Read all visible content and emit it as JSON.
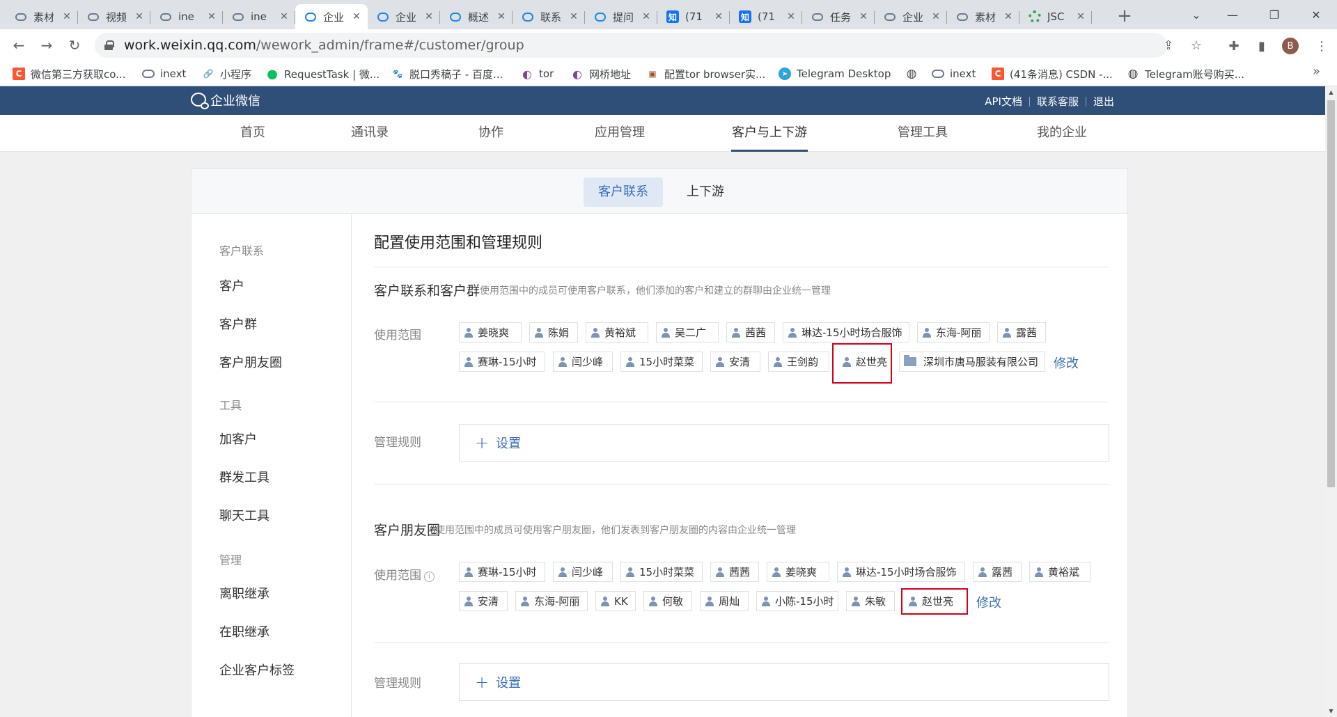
{
  "browser": {
    "tabs": [
      {
        "title": "素材",
        "icon": "cloud-icon"
      },
      {
        "title": "视频",
        "icon": "cloud-icon"
      },
      {
        "title": "ine",
        "icon": "cloud-icon"
      },
      {
        "title": "ine",
        "icon": "cloud-icon"
      },
      {
        "title": "企业",
        "icon": "wecom-icon",
        "active": true
      },
      {
        "title": "企业",
        "icon": "wecom-icon"
      },
      {
        "title": "概述",
        "icon": "wecom-icon"
      },
      {
        "title": "联系",
        "icon": "wecom-icon"
      },
      {
        "title": "提问",
        "icon": "wecom-icon"
      },
      {
        "title": "(71",
        "icon": "zhihu-icon"
      },
      {
        "title": "(71",
        "icon": "zhihu-icon"
      },
      {
        "title": "任务",
        "icon": "cloud-icon"
      },
      {
        "title": "企业",
        "icon": "cloud-icon"
      },
      {
        "title": "素材",
        "icon": "cloud-icon"
      },
      {
        "title": "JSC",
        "icon": "gear-icon"
      }
    ],
    "zhi_glyph": "知",
    "close_glyph": "✕",
    "new_tab_glyph": "+",
    "window_controls": {
      "dropdown": "⌄",
      "minimize": "—",
      "restore": "❐",
      "close": "✕"
    },
    "nav": {
      "back": "←",
      "forward": "→",
      "reload": "↻"
    },
    "url_host": "work.weixin.qq.com",
    "url_path": "/wework_admin/frame#/customer/group",
    "omnibox_icons": {
      "share": "⇪",
      "bookmark_star": "☆"
    },
    "extension_icons": {
      "extensions": "✚",
      "side_panel": "▮"
    },
    "profile_initial": "B",
    "bookmarks": [
      {
        "label": "微信第三方获取co...",
        "icon": "csdn-icon"
      },
      {
        "label": "inext",
        "icon": "cloud-icon"
      },
      {
        "label": "小程序",
        "icon": "link-icon"
      },
      {
        "label": "RequestTask | 微...",
        "icon": "wechat-icon"
      },
      {
        "label": "脱口秀稿子 - 百度...",
        "icon": "baidu-icon"
      },
      {
        "label": "tor",
        "icon": "tor-icon"
      },
      {
        "label": "网桥地址",
        "icon": "tor-icon"
      },
      {
        "label": "配置tor browser实...",
        "icon": "page-icon"
      },
      {
        "label": "Telegram Desktop",
        "icon": "telegram-icon"
      },
      {
        "label": "",
        "icon": "globe-icon"
      },
      {
        "label": "inext",
        "icon": "cloud-icon"
      },
      {
        "label": "(41条消息) CSDN -...",
        "icon": "csdn-icon"
      },
      {
        "label": "Telegram账号购买...",
        "icon": "globe-icon"
      }
    ],
    "bookmark_glyphs": {
      "csdn": "C",
      "link": "🔗",
      "wechat": "●",
      "baidu": "🐾",
      "tor": "◐",
      "page": "▣",
      "telegram": "➤",
      "globe": "◍"
    },
    "bookmarks_more": "»"
  },
  "header": {
    "logo_text": "企业微信",
    "links": [
      "API文档",
      "联系客服",
      "退出"
    ]
  },
  "nav": {
    "items": [
      "首页",
      "通讯录",
      "协作",
      "应用管理",
      "客户与上下游",
      "管理工具",
      "我的企业"
    ],
    "active_index": 4
  },
  "subtabs": {
    "items": [
      "客户联系",
      "上下游"
    ],
    "active_index": 0
  },
  "sidebar": {
    "groups": [
      {
        "heading": "客户联系",
        "items": [
          "客户",
          "客户群",
          "客户朋友圈"
        ]
      },
      {
        "heading": "工具",
        "items": [
          "加客户",
          "群发工具",
          "聊天工具"
        ]
      },
      {
        "heading": "管理",
        "items": [
          "离职继承",
          "在职继承",
          "企业客户标签"
        ]
      }
    ]
  },
  "main": {
    "title": "配置使用范围和管理规则",
    "section1": {
      "title": "客户联系和客户群",
      "desc": "使用范围中的成员可使用客户联系，他们添加的客户和建立的群聊由企业统一管理",
      "scope_label": "使用范围",
      "members_row1": [
        "姜晓爽",
        "陈娟",
        "黄裕斌",
        "吴二广",
        "茜茜",
        "琳达-15小时场合服饰",
        "东海-阿丽",
        "露茜"
      ],
      "members_row2": [
        "赛琳-15小时",
        "闫少峰",
        "15小时菜菜",
        "安清",
        "王剑韵",
        "赵世亮"
      ],
      "department": "深圳市唐马服装有限公司",
      "modify_label": "修改",
      "rules_label": "管理规则",
      "rules_button": "设置"
    },
    "section2": {
      "title": "客户朋友圈",
      "desc": "使用范围中的成员可使用客户朋友圈，他们发表到客户朋友圈的内容由企业统一管理",
      "scope_label": "使用范围",
      "info_glyph": "i",
      "members_row1": [
        "赛琳-15小时",
        "闫少峰",
        "15小时菜菜",
        "茜茜",
        "姜晓爽",
        "琳达-15小时场合服饰",
        "露茜",
        "黄裕斌"
      ],
      "members_row2": [
        "安清",
        "东海-阿丽",
        "KK",
        "何敏",
        "周灿",
        "小陈-15小时",
        "朱敏",
        "赵世亮"
      ],
      "modify_label": "修改",
      "rules_label": "管理规则",
      "rules_button": "设置"
    },
    "plus_glyph": "+"
  },
  "highlight_color": "#d0021b",
  "brand_color": "#2f4e78",
  "link_color": "#3a6eb5"
}
